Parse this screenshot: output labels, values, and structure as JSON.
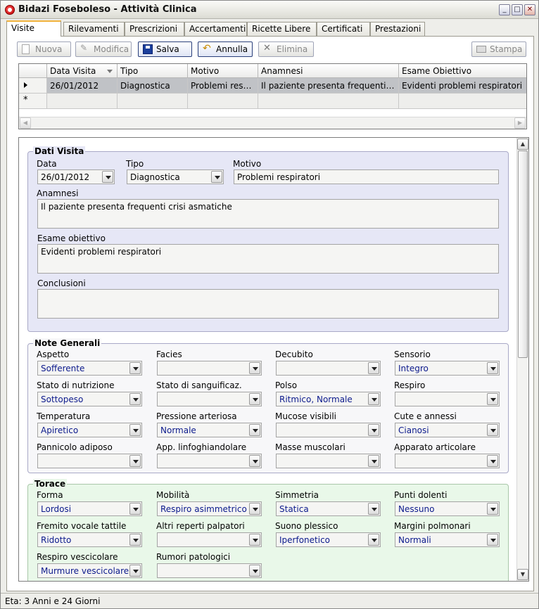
{
  "window": {
    "title": "Bidazi Foseboleso - Attività Clinica"
  },
  "tabs": [
    "Visite",
    "Rilevamenti",
    "Prescrizioni",
    "Accertamenti",
    "Ricette Libere",
    "Certificati",
    "Prestazioni"
  ],
  "toolbar": {
    "nuova": "Nuova",
    "modifica": "Modifica",
    "salva": "Salva",
    "annulla": "Annulla",
    "elimina": "Elimina",
    "stampa": "Stampa"
  },
  "grid": {
    "headers": [
      "Data Visita",
      "Tipo",
      "Motivo",
      "Anamnesi",
      "Esame Obiettivo"
    ],
    "row": [
      "26/01/2012",
      "Diagnostica",
      "Problemi respiratori",
      "Il paziente presenta frequenti crisi asmatiche",
      "Evidenti problemi respiratori"
    ],
    "new_row_marker": "*"
  },
  "dati_visita": {
    "title": "Dati Visita",
    "data_label": "Data",
    "data": "26/01/2012",
    "tipo_label": "Tipo",
    "tipo": "Diagnostica",
    "motivo_label": "Motivo",
    "motivo": "Problemi respiratori",
    "anamnesi_label": "Anamnesi",
    "anamnesi": "Il paziente presenta frequenti crisi asmatiche",
    "esame_label": "Esame obiettivo",
    "esame": "Evidenti problemi respiratori",
    "conclusioni_label": "Conclusioni",
    "conclusioni": ""
  },
  "note_generali": {
    "title": "Note Generali",
    "fields": [
      {
        "label": "Aspetto",
        "value": "Sofferente"
      },
      {
        "label": "Facies",
        "value": ""
      },
      {
        "label": "Decubito",
        "value": ""
      },
      {
        "label": "Sensorio",
        "value": "Integro"
      },
      {
        "label": "Stato di nutrizione",
        "value": "Sottopeso"
      },
      {
        "label": "Stato di sanguificaz.",
        "value": ""
      },
      {
        "label": "Polso",
        "value": "Ritmico, Normale"
      },
      {
        "label": "Respiro",
        "value": ""
      },
      {
        "label": "Temperatura",
        "value": "Apiretico"
      },
      {
        "label": "Pressione arteriosa",
        "value": "Normale"
      },
      {
        "label": "Mucose visibili",
        "value": ""
      },
      {
        "label": "Cute e annessi",
        "value": "Cianosi"
      },
      {
        "label": "Pannicolo adiposo",
        "value": ""
      },
      {
        "label": "App. linfoghiandolare",
        "value": ""
      },
      {
        "label": "Masse muscolari",
        "value": ""
      },
      {
        "label": "Apparato articolare",
        "value": ""
      }
    ]
  },
  "torace": {
    "title": "Torace",
    "fields": [
      {
        "label": "Forma",
        "value": "Lordosi"
      },
      {
        "label": "Mobilità",
        "value": "Respiro asimmetrico"
      },
      {
        "label": "Simmetria",
        "value": "Statica"
      },
      {
        "label": "Punti dolenti",
        "value": "Nessuno"
      },
      {
        "label": "Fremito vocale tattile",
        "value": "Ridotto"
      },
      {
        "label": "Altri reperti palpatori",
        "value": ""
      },
      {
        "label": "Suono plessico",
        "value": "Iperfonetico"
      },
      {
        "label": "Margini polmonari",
        "value": "Normali"
      },
      {
        "label": "Respiro vescicolare",
        "value": "Murmure vescicolare"
      },
      {
        "label": "Rumori patologici",
        "value": ""
      }
    ]
  },
  "status": "Eta: 3 Anni e 24 Giorni"
}
